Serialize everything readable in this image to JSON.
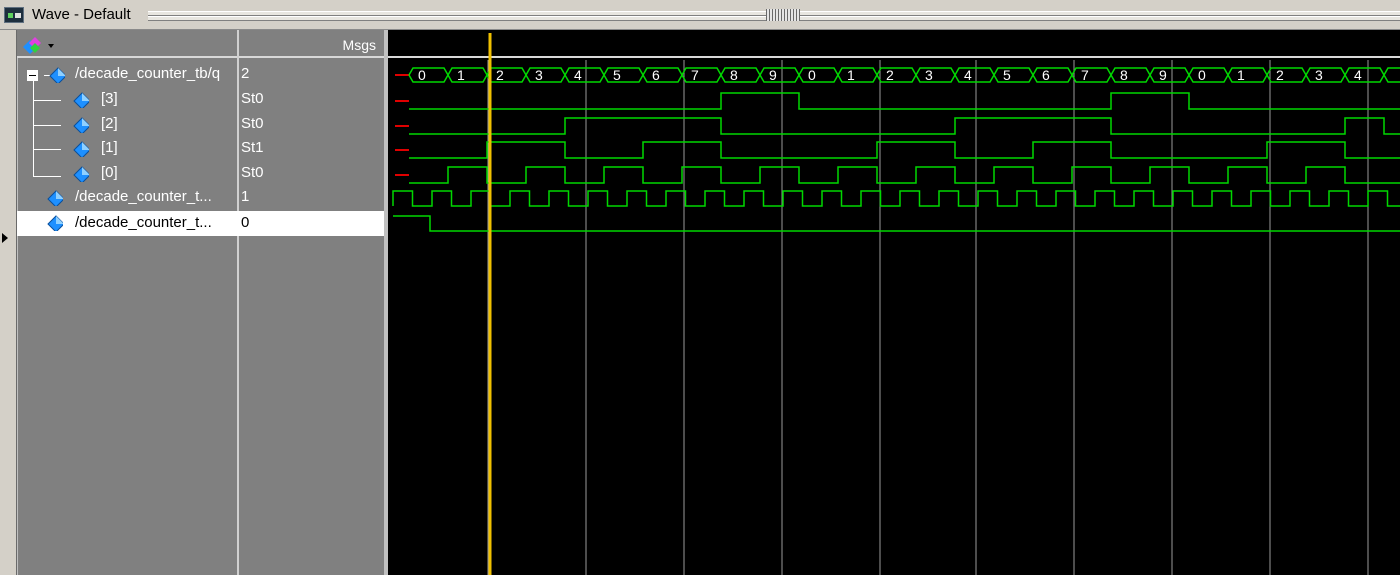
{
  "window": {
    "title": "Wave - Default"
  },
  "header": {
    "msgs_label": "Msgs",
    "toolbox_icon": "wave-toolbox-icon"
  },
  "signals": [
    {
      "name": "/decade_counter_tb/q",
      "value": "2"
    },
    {
      "name": "[3]",
      "value": "St0"
    },
    {
      "name": "[2]",
      "value": "St0"
    },
    {
      "name": "[1]",
      "value": "St1"
    },
    {
      "name": "[0]",
      "value": "St0"
    },
    {
      "name": "/decade_counter_t...",
      "value": "1"
    },
    {
      "name": "/decade_counter_t...",
      "value": "0"
    }
  ],
  "bus_values": [
    "0",
    "1",
    "2",
    "3",
    "4",
    "5",
    "6",
    "7",
    "8",
    "9",
    "0",
    "1",
    "2",
    "3",
    "4",
    "5",
    "6",
    "7",
    "8",
    "9",
    "0",
    "1",
    "2",
    "3",
    "4",
    ""
  ],
  "colors": {
    "wave": "#00d800",
    "cursor": "#f0c000",
    "grid": "#9a9a9a",
    "undefined": "#e00000"
  }
}
